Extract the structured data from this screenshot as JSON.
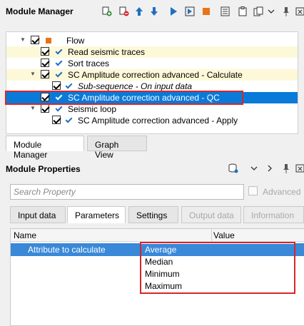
{
  "module_manager": {
    "title": "Module Manager",
    "toolbar": [
      "add-module-icon",
      "remove-module-icon",
      "move-up-icon",
      "move-down-icon",
      "run-icon",
      "step-run-icon",
      "stop-icon",
      "log-icon",
      "clipboard-icon",
      "copy-icon",
      "more-icon",
      "pin-icon",
      "close-icon"
    ],
    "tree": {
      "root": "Flow",
      "items": [
        {
          "label": "Read seismic traces",
          "highlighted": true
        },
        {
          "label": "Sort traces",
          "highlighted": false
        },
        {
          "label": "SC Amplitude correction advanced - Calculate",
          "highlighted": true
        },
        {
          "label": "Sub-sequence - On input data",
          "highlighted": false
        },
        {
          "label": "SC Amplitude correction advanced - QC",
          "selected": true
        },
        {
          "label": "Seismic loop",
          "highlighted": false
        },
        {
          "label": "SC Amplitude correction advanced - Apply",
          "highlighted": false
        }
      ]
    },
    "tabs": [
      "Module Manager",
      "Graph View"
    ]
  },
  "module_properties": {
    "title": "Module Properties",
    "search_placeholder": "Search Property",
    "advanced_label": "Advanced",
    "tabs": [
      "Input data",
      "Parameters",
      "Settings",
      "Output data",
      "Information"
    ],
    "active_tab": "Parameters",
    "columns": [
      "Name",
      "Value"
    ],
    "rows": [
      {
        "name": "Attribute to calculate",
        "value": "Average"
      }
    ],
    "dropdown_options": [
      "Average",
      "Median",
      "Minimum",
      "Maximum"
    ],
    "selected_option": "Average"
  },
  "colors": {
    "selection_blue": "#0a7ad8",
    "highlight_yellow": "#fdf8d8",
    "annotation_red": "#d6262b",
    "flow_orange": "#e8731a"
  }
}
